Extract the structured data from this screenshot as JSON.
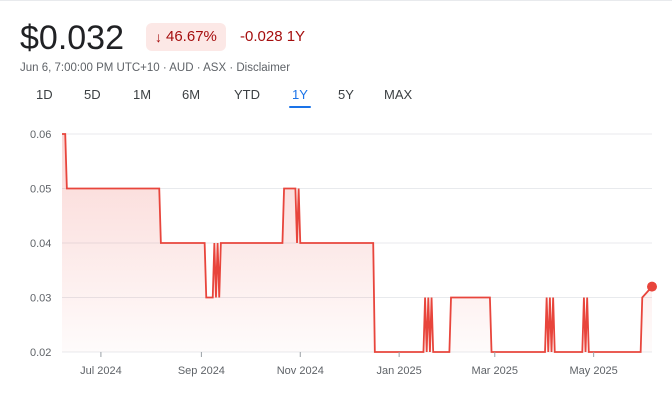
{
  "header": {
    "price": "$0.032",
    "pct_change": "46.67%",
    "pct_direction_icon": "arrow-down-icon",
    "abs_change": "-0.028 1Y",
    "meta": "Jun 6, 7:00:00 PM UTC+10 · AUD · ASX · Disclaimer"
  },
  "range_tabs": [
    {
      "label": "1D",
      "active": false
    },
    {
      "label": "5D",
      "active": false
    },
    {
      "label": "1M",
      "active": false
    },
    {
      "label": "6M",
      "active": false
    },
    {
      "label": "YTD",
      "active": false
    },
    {
      "label": "1Y",
      "active": true
    },
    {
      "label": "5Y",
      "active": false
    },
    {
      "label": "MAX",
      "active": false
    }
  ],
  "colors": {
    "line": "#e8453c",
    "down_text": "#a50e0e",
    "down_badge_bg": "#fce8e6",
    "active_tab": "#1a73e8"
  },
  "chart_data": {
    "type": "line",
    "title": "",
    "xlabel": "",
    "ylabel": "",
    "ylim": [
      0.02,
      0.06
    ],
    "y_ticks": [
      "0.06",
      "0.05",
      "0.04",
      "0.03",
      "0.02"
    ],
    "x_ticks": [
      "Jul 2024",
      "Sep 2024",
      "Nov 2024",
      "Jan 2025",
      "Mar 2025",
      "May 2025"
    ],
    "x_tick_dates": [
      "2024-07-01",
      "2024-09-01",
      "2024-11-01",
      "2025-01-01",
      "2025-03-01",
      "2025-05-01"
    ],
    "grid": "horizontal",
    "series": [
      {
        "x": [
          "2024-06-07",
          "2024-06-09",
          "2024-06-10",
          "2024-08-06",
          "2024-08-07",
          "2024-09-03",
          "2024-09-04",
          "2024-09-08",
          "2024-09-09",
          "2024-09-10",
          "2024-09-11",
          "2024-09-12",
          "2024-09-13",
          "2024-10-21",
          "2024-10-22",
          "2024-10-29",
          "2024-10-30",
          "2024-10-31",
          "2024-11-01",
          "2024-11-02",
          "2024-12-16",
          "2024-12-17",
          "2025-01-16",
          "2025-01-17",
          "2025-01-18",
          "2025-01-19",
          "2025-01-20",
          "2025-01-21",
          "2025-01-22",
          "2025-02-01",
          "2025-02-02",
          "2025-02-26",
          "2025-02-27",
          "2025-04-01",
          "2025-04-02",
          "2025-04-03",
          "2025-04-04",
          "2025-04-05",
          "2025-04-06",
          "2025-04-07",
          "2025-04-08",
          "2025-04-24",
          "2025-04-25",
          "2025-04-26",
          "2025-04-27",
          "2025-04-28",
          "2025-05-30",
          "2025-05-31",
          "2025-06-06"
        ],
        "values": [
          0.06,
          0.06,
          0.05,
          0.05,
          0.04,
          0.04,
          0.03,
          0.03,
          0.04,
          0.03,
          0.04,
          0.03,
          0.04,
          0.04,
          0.05,
          0.05,
          0.04,
          0.05,
          0.04,
          0.04,
          0.04,
          0.02,
          0.02,
          0.03,
          0.02,
          0.03,
          0.02,
          0.03,
          0.02,
          0.02,
          0.03,
          0.03,
          0.02,
          0.02,
          0.03,
          0.02,
          0.03,
          0.02,
          0.03,
          0.02,
          0.02,
          0.02,
          0.03,
          0.02,
          0.03,
          0.02,
          0.02,
          0.03,
          0.032
        ]
      }
    ],
    "last_point": {
      "x": "2025-06-06",
      "y": 0.032
    }
  }
}
